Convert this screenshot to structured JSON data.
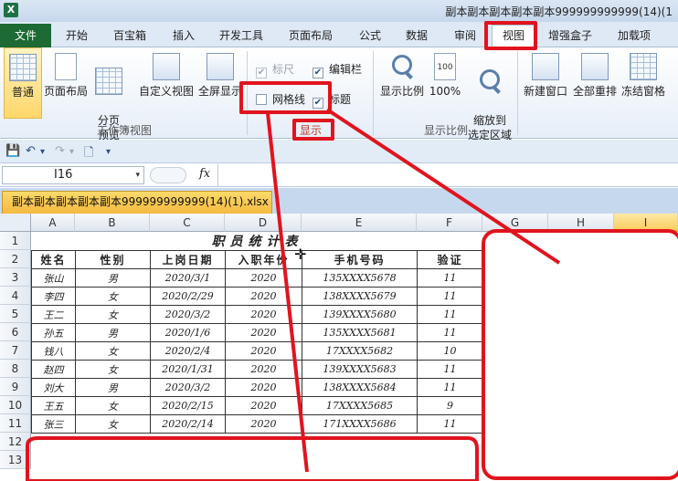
{
  "window": {
    "app_icon": "X",
    "title": "副本副本副本副本副本999999999999(14)(1"
  },
  "ribbon_tabs": [
    "文件",
    "开始",
    "百宝箱",
    "插入",
    "开发工具",
    "页面布局",
    "公式",
    "数据",
    "审阅",
    "视图",
    "增强盒子",
    "加载项"
  ],
  "active_tab": "视图",
  "ribbon": {
    "workbook_views": {
      "label": "工作簿视图",
      "buttons": [
        "普通",
        "页面布局",
        "分页\n预览",
        "自定义视图",
        "全屏显示"
      ]
    },
    "show": {
      "label": "显示",
      "checkboxes": [
        {
          "label": "标尺",
          "checked": true,
          "disabled": true
        },
        {
          "label": "编辑栏",
          "checked": true,
          "disabled": false
        },
        {
          "label": "网格线",
          "checked": false,
          "disabled": false
        },
        {
          "label": "标题",
          "checked": true,
          "disabled": false
        }
      ]
    },
    "zoom": {
      "label": "显示比例",
      "buttons": [
        "显示比例",
        "100%",
        "缩放到\n选定区域"
      ],
      "hundred_icon": "100"
    },
    "window_group": {
      "buttons": [
        "新建窗口",
        "全部重排",
        "冻结窗格"
      ]
    }
  },
  "quick_access": {
    "save": "💾",
    "undo": "↶",
    "redo": "↷",
    "dropdown": "▾",
    "new": "🗋"
  },
  "formula_bar": {
    "name_box": "I16",
    "fx": "fx",
    "dropdown": "▾"
  },
  "document_tab": "副本副本副本副本副本999999999999(14)(1).xlsx",
  "sheet": {
    "columns": [
      "A",
      "B",
      "C",
      "D",
      "E",
      "F",
      "G",
      "H",
      "I"
    ],
    "selected_column": "I",
    "rows": [
      "1",
      "2",
      "3",
      "4",
      "5",
      "6",
      "7",
      "8",
      "9",
      "10",
      "11",
      "12",
      "13"
    ],
    "table_title": "职员统计表",
    "headers": [
      "姓名",
      "性别",
      "上岗日期",
      "入职年份",
      "手机号码",
      "验证"
    ],
    "records": [
      [
        "张山",
        "男",
        "2020/3/1",
        "2020",
        "135XXXX5678",
        "11"
      ],
      [
        "李四",
        "女",
        "2020/2/29",
        "2020",
        "138XXXX5679",
        "11"
      ],
      [
        "王二",
        "女",
        "2020/3/2",
        "2020",
        "139XXXX5680",
        "11"
      ],
      [
        "孙五",
        "男",
        "2020/1/6",
        "2020",
        "135XXXX5681",
        "11"
      ],
      [
        "钱八",
        "女",
        "2020/2/4",
        "2020",
        "17XXXX5682",
        "10"
      ],
      [
        "赵四",
        "女",
        "2020/1/31",
        "2020",
        "139XXXX5683",
        "11"
      ],
      [
        "刘大",
        "男",
        "2020/3/2",
        "2020",
        "138XXXX5684",
        "11"
      ],
      [
        "王五",
        "女",
        "2020/2/15",
        "2020",
        "17XXXX5685",
        "9"
      ],
      [
        "张三",
        "女",
        "2020/2/14",
        "2020",
        "171XXXX5686",
        "11"
      ]
    ]
  },
  "colors": {
    "annotation": "#e0141e",
    "file_tab": "#1d6a34",
    "doc_tab": "#f5b941"
  }
}
